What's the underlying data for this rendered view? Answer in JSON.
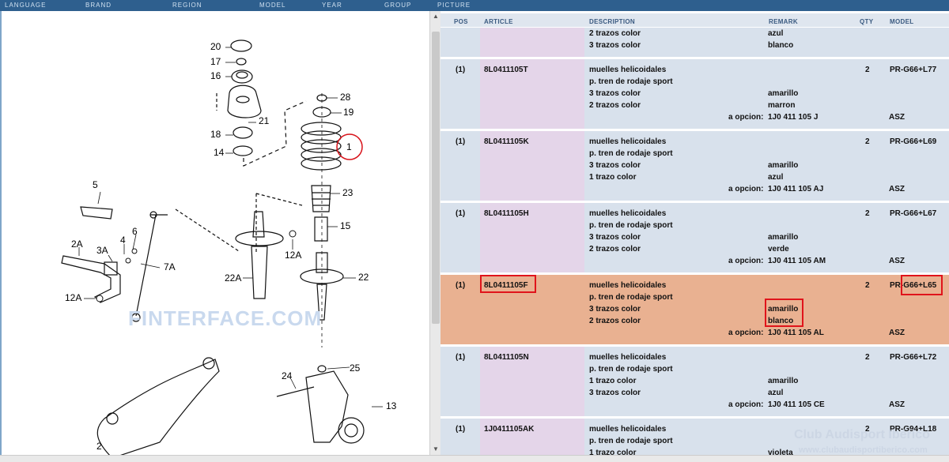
{
  "nav": [
    "LANGUAGE",
    "BRAND",
    "REGION",
    "MODEL",
    "YEAR",
    "GROUP",
    "PICTURE"
  ],
  "columns": {
    "pos": "POS",
    "article": "ARTICLE",
    "description": "DESCRIPTION",
    "remark": "REMARK",
    "qty": "QTY",
    "model": "MODEL"
  },
  "rows": [
    {
      "pos": "",
      "article": "",
      "qty": "",
      "model": "",
      "lines": [
        {
          "desc": "2 trazos color",
          "remark": "azul"
        },
        {
          "desc": "3 trazos color",
          "remark": "blanco"
        }
      ]
    },
    {
      "pos": "(1)",
      "article": "8L0411105T",
      "qty": "2",
      "model": "PR-G66+L77",
      "lines": [
        {
          "desc": "muelles helicoidales",
          "remark": ""
        },
        {
          "desc": "p. tren de rodaje sport",
          "remark": ""
        },
        {
          "desc": "3 trazos color",
          "remark": "amarillo"
        },
        {
          "desc": "2 trazos color",
          "remark": "marron"
        }
      ],
      "opcion_label": "a opcion:",
      "opcion": "1J0 411 105 J",
      "opcion_model": "ASZ"
    },
    {
      "pos": "(1)",
      "article": "8L0411105K",
      "qty": "2",
      "model": "PR-G66+L69",
      "lines": [
        {
          "desc": "muelles helicoidales",
          "remark": ""
        },
        {
          "desc": "p. tren de rodaje sport",
          "remark": ""
        },
        {
          "desc": "3 trazos color",
          "remark": "amarillo"
        },
        {
          "desc": "1 trazo color",
          "remark": "azul"
        }
      ],
      "opcion_label": "a opcion:",
      "opcion": "1J0 411 105 AJ",
      "opcion_model": "ASZ"
    },
    {
      "pos": "(1)",
      "article": "8L0411105H",
      "qty": "2",
      "model": "PR-G66+L67",
      "lines": [
        {
          "desc": "muelles helicoidales",
          "remark": ""
        },
        {
          "desc": "p. tren de rodaje sport",
          "remark": ""
        },
        {
          "desc": "3 trazos color",
          "remark": "amarillo"
        },
        {
          "desc": "2 trazos color",
          "remark": "verde"
        }
      ],
      "opcion_label": "a opcion:",
      "opcion": "1J0 411 105 AM",
      "opcion_model": "ASZ"
    },
    {
      "pos": "(1)",
      "article": "8L0411105F",
      "qty": "2",
      "model": "PR-G66+L65",
      "selected": true,
      "lines": [
        {
          "desc": "muelles helicoidales",
          "remark": ""
        },
        {
          "desc": "p. tren de rodaje sport",
          "remark": ""
        },
        {
          "desc": "3 trazos color",
          "remark": "amarillo"
        },
        {
          "desc": "2 trazos color",
          "remark": "blanco"
        }
      ],
      "opcion_label": "a opcion:",
      "opcion": "1J0 411 105 AL",
      "opcion_model": "ASZ"
    },
    {
      "pos": "(1)",
      "article": "8L0411105N",
      "qty": "2",
      "model": "PR-G66+L72",
      "lines": [
        {
          "desc": "muelles helicoidales",
          "remark": ""
        },
        {
          "desc": "p. tren de rodaje sport",
          "remark": ""
        },
        {
          "desc": "1 trazo color",
          "remark": "amarillo"
        },
        {
          "desc": "3 trazos color",
          "remark": "azul"
        }
      ],
      "opcion_label": "a opcion:",
      "opcion": "1J0 411 105 CE",
      "opcion_model": "ASZ"
    },
    {
      "pos": "(1)",
      "article": "1J0411105AK",
      "qty": "2",
      "model": "PR-G94+L18",
      "lines": [
        {
          "desc": "muelles helicoidales",
          "remark": ""
        },
        {
          "desc": "p. tren de rodaje sport",
          "remark": ""
        },
        {
          "desc": "1 trazo color",
          "remark": "violeta"
        }
      ]
    }
  ],
  "diagram_labels": [
    "20",
    "17",
    "16",
    "18",
    "21",
    "14",
    "28",
    "19",
    "1",
    "23",
    "15",
    "5",
    "2A",
    "6",
    "4",
    "3A",
    "7A",
    "12A",
    "12A",
    "22A",
    "22",
    "24",
    "25",
    "13",
    "2"
  ],
  "watermark_left": "FINTERFACE.COM",
  "watermark_right": "Club Audisport Ibérico",
  "watermark_url": "www.clubaudisportiberico.com",
  "colors": {
    "selected_row": "#e9b191",
    "row": "#d8e1ec",
    "article_col": "#e4d5e9",
    "highlight": "#e0141b",
    "nav": "#2e5f8e"
  }
}
